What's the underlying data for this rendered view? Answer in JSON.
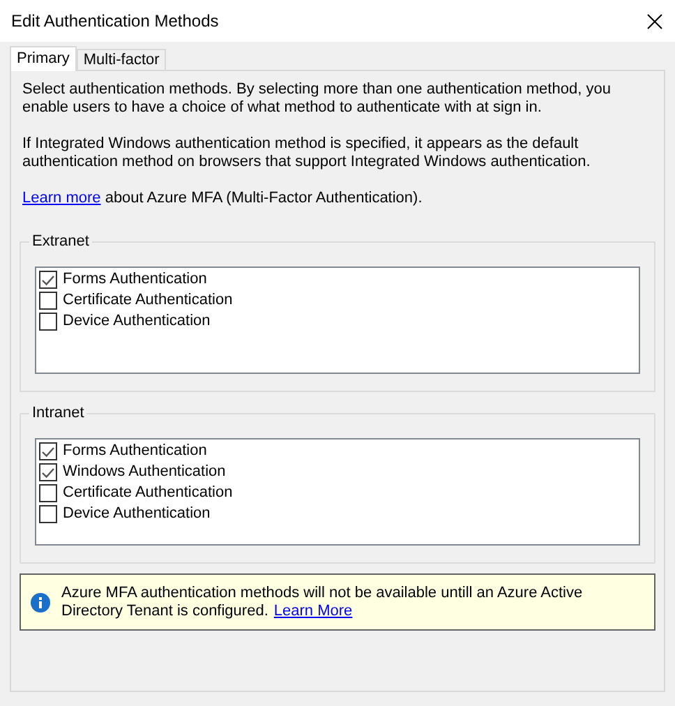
{
  "window": {
    "title": "Edit Authentication Methods"
  },
  "tabs": [
    {
      "label": "Primary",
      "selected": true
    },
    {
      "label": "Multi-factor",
      "selected": false
    }
  ],
  "intro": [
    "Select authentication methods. By selecting more than one authentication method, you enable users to have a choice of what method to authenticate with at sign in.",
    "If Integrated Windows authentication method is specified, it appears as the default authentication method on browsers that support Integrated Windows authentication."
  ],
  "learn_more": {
    "link": "Learn more",
    "text": " about Azure MFA (Multi-Factor Authentication)."
  },
  "groups": [
    {
      "title": "Extranet",
      "items": [
        {
          "label": "Forms Authentication",
          "checked": true
        },
        {
          "label": "Certificate Authentication",
          "checked": false
        },
        {
          "label": "Device Authentication",
          "checked": false
        }
      ]
    },
    {
      "title": "Intranet",
      "items": [
        {
          "label": "Forms Authentication",
          "checked": true
        },
        {
          "label": "Windows Authentication",
          "checked": true
        },
        {
          "label": "Certificate Authentication",
          "checked": false
        },
        {
          "label": "Device Authentication",
          "checked": false
        }
      ]
    }
  ],
  "info": {
    "text": "Azure MFA authentication methods will not be available untill an Azure Active Directory Tenant is configured.",
    "link": "Learn More"
  }
}
